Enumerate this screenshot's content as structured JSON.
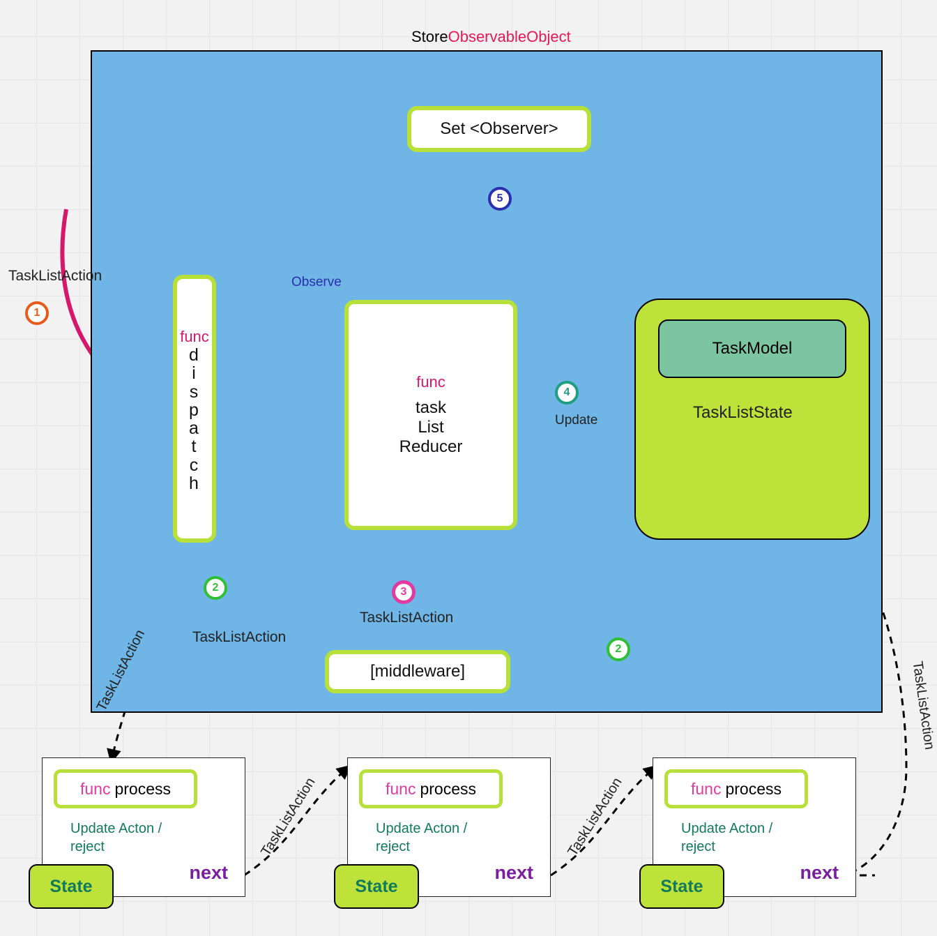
{
  "title": {
    "store": "Store",
    "observable": "ObservableObject"
  },
  "store": {
    "observer_box": "Set <Observer>",
    "dispatch": {
      "keyword": "func",
      "name": "dispatch"
    },
    "reducer": {
      "keyword": "func",
      "lines": [
        "task",
        "List",
        "Reducer"
      ]
    },
    "state": {
      "model": "TaskModel",
      "name": "TaskListState"
    },
    "middleware": "[middleware]"
  },
  "edges": {
    "action_in": "TaskListAction",
    "observe": "Observe",
    "update": "Update",
    "dispatch_to_mw": "TaskListAction",
    "mw_to_reducer": "TaskListAction",
    "chain_label": "TaskListAction"
  },
  "badges": {
    "b1": "1",
    "b2a": "2",
    "b2b": "2",
    "b3": "3",
    "b4": "4",
    "b5": "5"
  },
  "process_box": {
    "keyword": "func",
    "name": "process",
    "subtitle1": "Update Acton /",
    "subtitle2": "reject",
    "state": "State",
    "next": "next"
  },
  "colors": {
    "lime": "#b8e03a",
    "blue_bg": "#6fb5e6",
    "teal": "#1e9e82",
    "green": "#2fbf36",
    "navy": "#2a2fad",
    "magenta": "#d6186d",
    "pink": "#e13aa0",
    "orange": "#e85a1a",
    "purple": "#7a1ea0"
  }
}
